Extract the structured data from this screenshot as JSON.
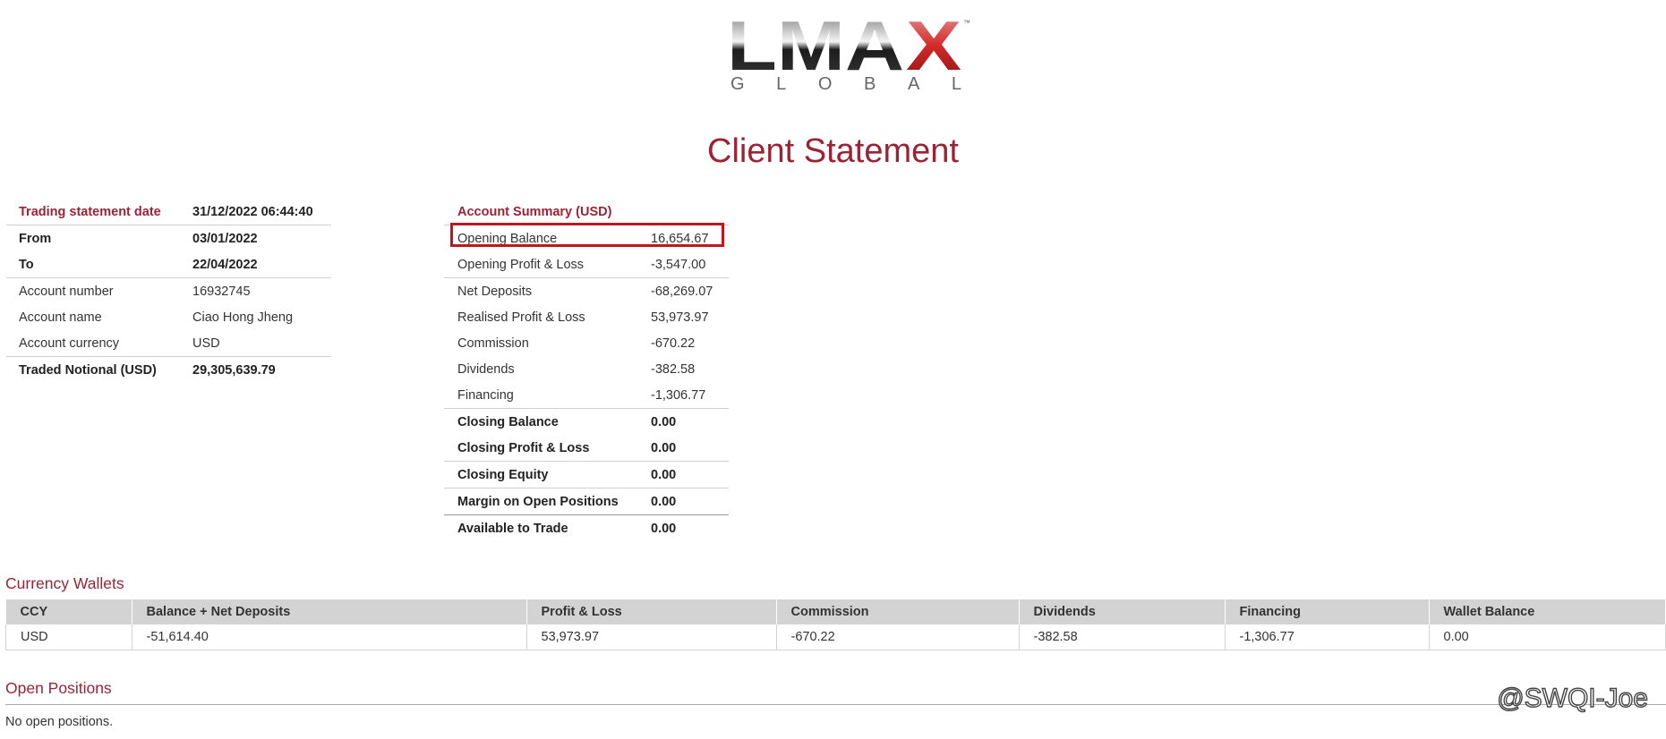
{
  "header": {
    "logo_main": "LMAX",
    "logo_sub": "G L O B A L",
    "title": "Client Statement"
  },
  "info": [
    {
      "label": "Trading statement date",
      "value": "31/12/2022 06:44:40"
    },
    {
      "label": "From",
      "value": "03/01/2022"
    },
    {
      "label": "To",
      "value": "22/04/2022"
    },
    {
      "label": "Account number",
      "value": "16932745"
    },
    {
      "label": "Account name",
      "value": "Ciao Hong Jheng"
    },
    {
      "label": "Account currency",
      "value": "USD"
    },
    {
      "label": "Traded Notional (USD)",
      "value": "29,305,639.79"
    }
  ],
  "summary": {
    "heading": "Account Summary (USD)",
    "rows": [
      {
        "label": "Opening Balance",
        "value": "16,654.67"
      },
      {
        "label": "Opening Profit & Loss",
        "value": "-3,547.00"
      },
      {
        "label": "Net Deposits",
        "value": "-68,269.07"
      },
      {
        "label": "Realised Profit & Loss",
        "value": "53,973.97"
      },
      {
        "label": "Commission",
        "value": "-670.22"
      },
      {
        "label": "Dividends",
        "value": "-382.58"
      },
      {
        "label": "Financing",
        "value": "-1,306.77"
      },
      {
        "label": "Closing Balance",
        "value": "0.00"
      },
      {
        "label": "Closing Profit & Loss",
        "value": "0.00"
      },
      {
        "label": "Closing Equity",
        "value": "0.00"
      },
      {
        "label": "Margin on Open Positions",
        "value": "0.00"
      },
      {
        "label": "Available to Trade",
        "value": "0.00"
      }
    ]
  },
  "wallets": {
    "title": "Currency Wallets",
    "columns": [
      "CCY",
      "Balance + Net Deposits",
      "Profit & Loss",
      "Commission",
      "Dividends",
      "Financing",
      "Wallet Balance"
    ],
    "rows": [
      [
        "USD",
        "-51,614.40",
        "53,973.97",
        "-670.22",
        "-382.58",
        "-1,306.77",
        "0.00"
      ]
    ]
  },
  "open_positions": {
    "title": "Open Positions",
    "empty_text": "No open positions."
  },
  "watermark": "@SWQI-Joe",
  "colors": {
    "accent": "#9b2335",
    "highlight_border": "#c0161d"
  }
}
